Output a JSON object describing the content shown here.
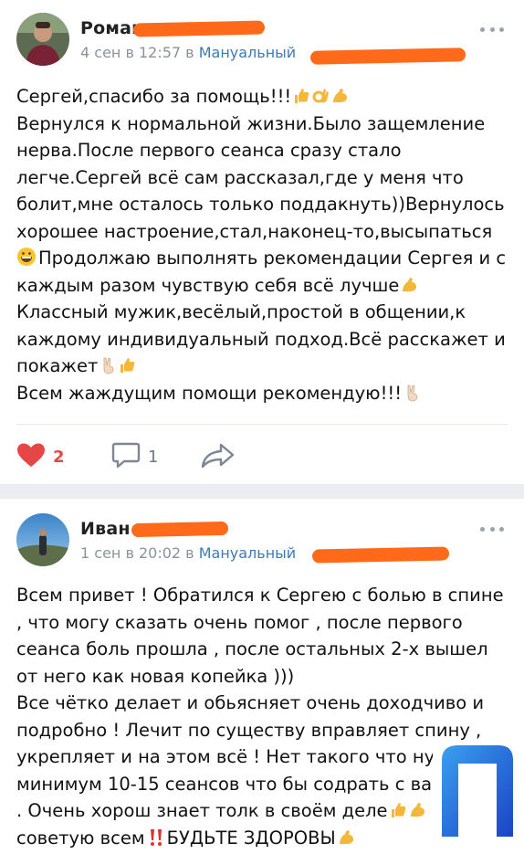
{
  "posts": [
    {
      "author_name": "Роман",
      "date": "4 сен в 12:57",
      "preposition": "в",
      "group": "Мануальный",
      "text_lines": [
        "Сергей,спасибо за помощь!!!",
        "Вернулся к нормальной жизни.Было защемление",
        "нерва.После первого сеанса сразу стало",
        "легче.Сергей всё сам рассказал,где у меня что",
        "болит,мне осталось только поддакнуть))Вернулось",
        "хорошее настроение,стал,наконец-то,высыпаться",
        "Продолжаю выполнять рекомендации Сергея и с",
        "каждым разом чувствую себя всё лучше",
        "Классный мужик,весёлый,простой в общении,к",
        "каждому индивидуальный подход.Всё расскажет и",
        "покажет",
        "Всем жаждущим помощи рекомендую!!!"
      ],
      "likes": "2",
      "comments": "1",
      "icons": {
        "like": "heart-icon",
        "comment": "comment-icon",
        "share": "share-icon",
        "more": "more-dots-icon"
      }
    },
    {
      "author_name": "Иван",
      "date": "1 сен в 20:02",
      "preposition": "в",
      "group": "Мануальный",
      "text_lines": [
        "Всем привет ! Обратился к Сергею с болью в спине",
        ", что могу сказать очень помог , после первого",
        "сеанса боль прошла , после остальных 2-х вышел",
        "от него как новая копейка )))",
        "Все чётко делает и обьясняет очень доходчиво и",
        "подробно ! Лечит по существу вправляет спину ,",
        "укрепляет и на этом всё ! Нет такого что нужно",
        "минимум 10-15 сеансов что бы содрать с вас денег",
        ". Очень хорош знает толк в своём деле",
        "советую всем",
        "БУДЬТЕ ЗДОРОВЫ"
      ],
      "icons": {
        "more": "more-dots-icon"
      }
    }
  ],
  "colors": {
    "like_red": "#e64646",
    "link_blue": "#3e7bb5",
    "meta_gray": "#8a939c",
    "redaction_orange": "#ff6a1a",
    "separator": "#ebedf0"
  }
}
